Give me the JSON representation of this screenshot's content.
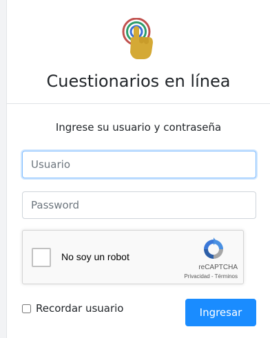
{
  "header": {
    "logo_icon": "touch-hand-logo-icon",
    "title": "Cuestionarios en línea"
  },
  "form": {
    "subtitle": "Ingrese su usuario y contraseña",
    "username": {
      "placeholder": "Usuario",
      "value": ""
    },
    "password": {
      "placeholder": "Password",
      "value": ""
    },
    "recaptcha": {
      "label": "No soy un robot",
      "brand": "reCAPTCHA",
      "privacy": "Privacidad",
      "separator": " - ",
      "terms": "Términos",
      "icon": "recaptcha-logo-icon"
    },
    "remember_label": "Recordar usuario",
    "remember_checked": false,
    "submit_label": "Ingresar"
  },
  "colors": {
    "primary": "#1a8cff",
    "focus_border": "#80bdff",
    "logo_hand": "#d4a935",
    "logo_ring_outer": "#c0504d",
    "logo_ring_middle": "#2e9c6a",
    "logo_ring_inner": "#3b6fd6"
  }
}
